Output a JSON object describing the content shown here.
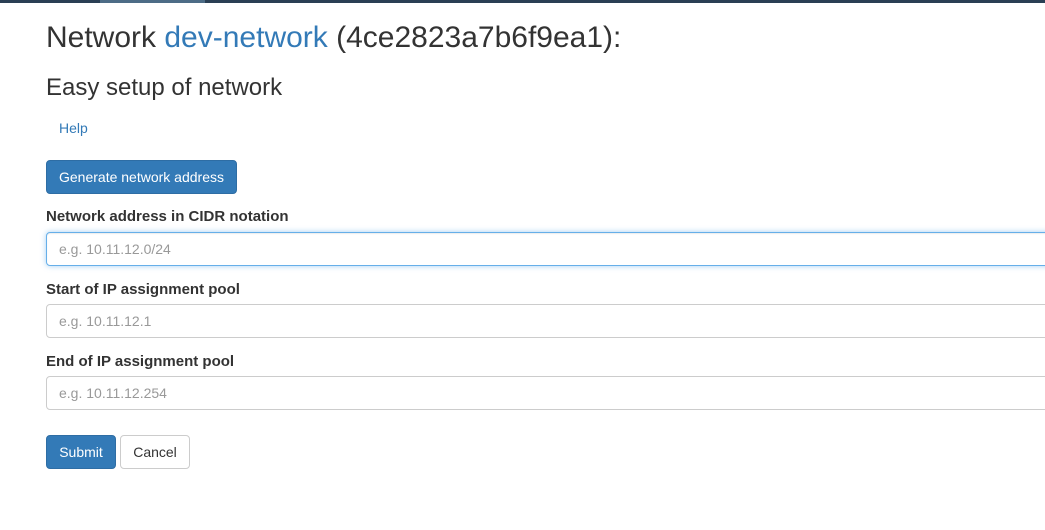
{
  "header": {
    "title_prefix": "Network",
    "network_name": "dev-network",
    "network_id_suffix": "(4ce2823a7b6f9ea1):"
  },
  "setup": {
    "subtitle": "Easy setup of network",
    "help_label": "Help",
    "generate_label": "Generate network address"
  },
  "form": {
    "cidr": {
      "label": "Network address in CIDR notation",
      "value": "",
      "placeholder": "e.g. 10.11.12.0/24"
    },
    "pool_start": {
      "label": "Start of IP assignment pool",
      "value": "",
      "placeholder": "e.g. 10.11.12.1"
    },
    "pool_end": {
      "label": "End of IP assignment pool",
      "value": "",
      "placeholder": "e.g. 10.11.12.254"
    },
    "submit_label": "Submit",
    "cancel_label": "Cancel"
  },
  "colors": {
    "link": "#337ab7",
    "primary_button": "#337ab7",
    "focus_border": "#66afe9",
    "topbar": "#2a3f54"
  }
}
